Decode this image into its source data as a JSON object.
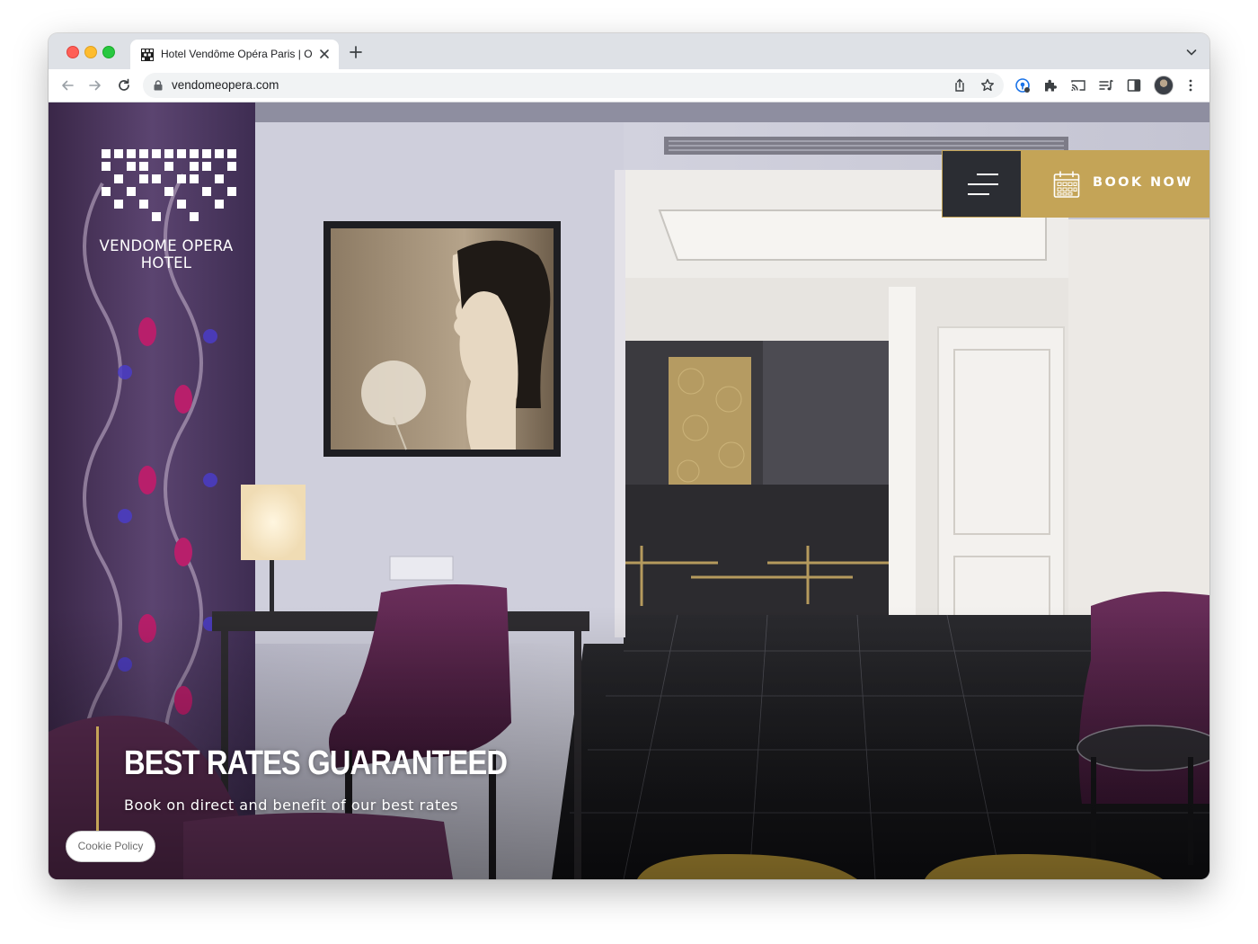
{
  "browser": {
    "tab_title": "Hotel Vendôme Opéra Paris | O",
    "url": "vendomeopera.com"
  },
  "hotel": {
    "logo_line1": "VENDOME OPERA",
    "logo_line2": "HOTEL"
  },
  "header": {
    "book_label": "BOOK NOW"
  },
  "hero": {
    "title": "BEST RATES GUARANTEED",
    "subtitle": "Book on direct and benefit of our best rates"
  },
  "cookie": {
    "label": "Cookie Policy"
  },
  "colors": {
    "gold": "#c4a457",
    "dark": "#2b2d33",
    "purple": "#4a2a4f"
  },
  "icons": [
    "favicon-icon",
    "close-icon",
    "plus-icon",
    "chevron-down-icon",
    "back-icon",
    "forward-icon",
    "reload-icon",
    "lock-icon",
    "share-icon",
    "bookmark-star-icon",
    "password-manager-icon",
    "extensions-icon",
    "cast-icon",
    "media-icon",
    "side-panel-icon",
    "more-icon",
    "menu-icon",
    "calendar-icon"
  ]
}
